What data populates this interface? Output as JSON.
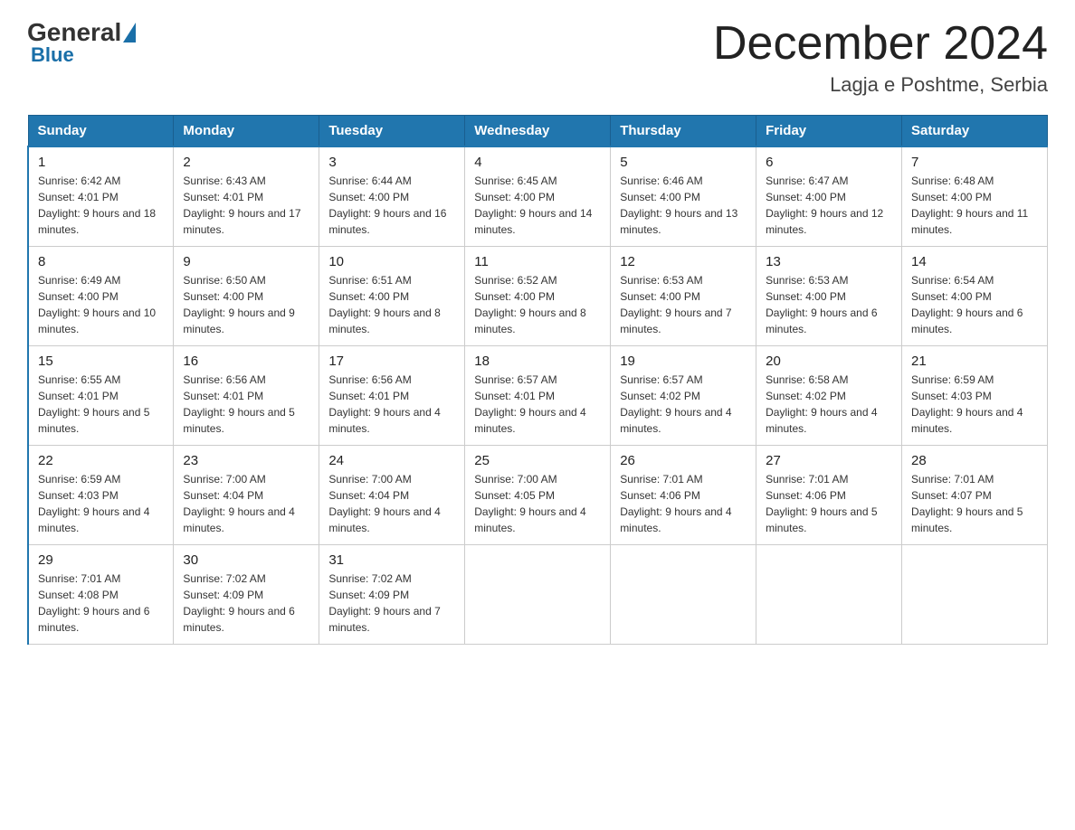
{
  "header": {
    "logo_general": "General",
    "logo_blue": "Blue",
    "month_title": "December 2024",
    "subtitle": "Lagja e Poshtme, Serbia"
  },
  "days_of_week": [
    "Sunday",
    "Monday",
    "Tuesday",
    "Wednesday",
    "Thursday",
    "Friday",
    "Saturday"
  ],
  "weeks": [
    [
      {
        "day": "1",
        "sunrise": "6:42 AM",
        "sunset": "4:01 PM",
        "daylight": "9 hours and 18 minutes."
      },
      {
        "day": "2",
        "sunrise": "6:43 AM",
        "sunset": "4:01 PM",
        "daylight": "9 hours and 17 minutes."
      },
      {
        "day": "3",
        "sunrise": "6:44 AM",
        "sunset": "4:00 PM",
        "daylight": "9 hours and 16 minutes."
      },
      {
        "day": "4",
        "sunrise": "6:45 AM",
        "sunset": "4:00 PM",
        "daylight": "9 hours and 14 minutes."
      },
      {
        "day": "5",
        "sunrise": "6:46 AM",
        "sunset": "4:00 PM",
        "daylight": "9 hours and 13 minutes."
      },
      {
        "day": "6",
        "sunrise": "6:47 AM",
        "sunset": "4:00 PM",
        "daylight": "9 hours and 12 minutes."
      },
      {
        "day": "7",
        "sunrise": "6:48 AM",
        "sunset": "4:00 PM",
        "daylight": "9 hours and 11 minutes."
      }
    ],
    [
      {
        "day": "8",
        "sunrise": "6:49 AM",
        "sunset": "4:00 PM",
        "daylight": "9 hours and 10 minutes."
      },
      {
        "day": "9",
        "sunrise": "6:50 AM",
        "sunset": "4:00 PM",
        "daylight": "9 hours and 9 minutes."
      },
      {
        "day": "10",
        "sunrise": "6:51 AM",
        "sunset": "4:00 PM",
        "daylight": "9 hours and 8 minutes."
      },
      {
        "day": "11",
        "sunrise": "6:52 AM",
        "sunset": "4:00 PM",
        "daylight": "9 hours and 8 minutes."
      },
      {
        "day": "12",
        "sunrise": "6:53 AM",
        "sunset": "4:00 PM",
        "daylight": "9 hours and 7 minutes."
      },
      {
        "day": "13",
        "sunrise": "6:53 AM",
        "sunset": "4:00 PM",
        "daylight": "9 hours and 6 minutes."
      },
      {
        "day": "14",
        "sunrise": "6:54 AM",
        "sunset": "4:00 PM",
        "daylight": "9 hours and 6 minutes."
      }
    ],
    [
      {
        "day": "15",
        "sunrise": "6:55 AM",
        "sunset": "4:01 PM",
        "daylight": "9 hours and 5 minutes."
      },
      {
        "day": "16",
        "sunrise": "6:56 AM",
        "sunset": "4:01 PM",
        "daylight": "9 hours and 5 minutes."
      },
      {
        "day": "17",
        "sunrise": "6:56 AM",
        "sunset": "4:01 PM",
        "daylight": "9 hours and 4 minutes."
      },
      {
        "day": "18",
        "sunrise": "6:57 AM",
        "sunset": "4:01 PM",
        "daylight": "9 hours and 4 minutes."
      },
      {
        "day": "19",
        "sunrise": "6:57 AM",
        "sunset": "4:02 PM",
        "daylight": "9 hours and 4 minutes."
      },
      {
        "day": "20",
        "sunrise": "6:58 AM",
        "sunset": "4:02 PM",
        "daylight": "9 hours and 4 minutes."
      },
      {
        "day": "21",
        "sunrise": "6:59 AM",
        "sunset": "4:03 PM",
        "daylight": "9 hours and 4 minutes."
      }
    ],
    [
      {
        "day": "22",
        "sunrise": "6:59 AM",
        "sunset": "4:03 PM",
        "daylight": "9 hours and 4 minutes."
      },
      {
        "day": "23",
        "sunrise": "7:00 AM",
        "sunset": "4:04 PM",
        "daylight": "9 hours and 4 minutes."
      },
      {
        "day": "24",
        "sunrise": "7:00 AM",
        "sunset": "4:04 PM",
        "daylight": "9 hours and 4 minutes."
      },
      {
        "day": "25",
        "sunrise": "7:00 AM",
        "sunset": "4:05 PM",
        "daylight": "9 hours and 4 minutes."
      },
      {
        "day": "26",
        "sunrise": "7:01 AM",
        "sunset": "4:06 PM",
        "daylight": "9 hours and 4 minutes."
      },
      {
        "day": "27",
        "sunrise": "7:01 AM",
        "sunset": "4:06 PM",
        "daylight": "9 hours and 5 minutes."
      },
      {
        "day": "28",
        "sunrise": "7:01 AM",
        "sunset": "4:07 PM",
        "daylight": "9 hours and 5 minutes."
      }
    ],
    [
      {
        "day": "29",
        "sunrise": "7:01 AM",
        "sunset": "4:08 PM",
        "daylight": "9 hours and 6 minutes."
      },
      {
        "day": "30",
        "sunrise": "7:02 AM",
        "sunset": "4:09 PM",
        "daylight": "9 hours and 6 minutes."
      },
      {
        "day": "31",
        "sunrise": "7:02 AM",
        "sunset": "4:09 PM",
        "daylight": "9 hours and 7 minutes."
      },
      null,
      null,
      null,
      null
    ]
  ]
}
